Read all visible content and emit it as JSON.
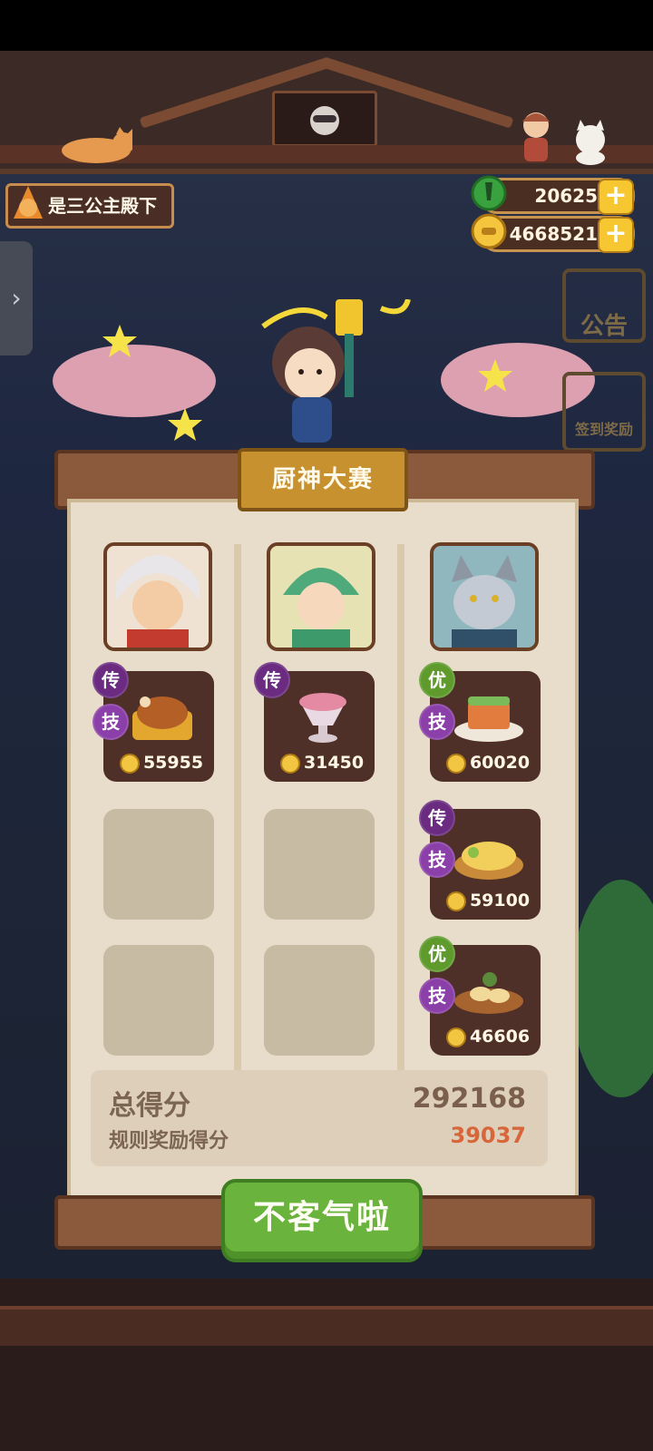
{
  "player": {
    "name": "是三公主殿下"
  },
  "currency": [
    {
      "icon": "green-gem-icon",
      "value": "20625",
      "plus": "+"
    },
    {
      "icon": "gold-coin-icon",
      "value": "4668521",
      "plus": "+"
    }
  ],
  "side_tab": {
    "arrow": "›"
  },
  "background_buttons": {
    "notice": "公告",
    "reward": "签到奖励"
  },
  "panel": {
    "title": "厨神大赛"
  },
  "columns": [
    {
      "chef": "white-haired-chef-portrait",
      "dishes": [
        {
          "badges": [
            "传",
            "技"
          ],
          "badge_colors": [
            "#6a2b80",
            "#8b3fa8"
          ],
          "icon": "roast-chicken-dish-icon",
          "score": "55955"
        }
      ],
      "empty_slots": 2
    },
    {
      "chef": "green-robed-chef-portrait",
      "dishes": [
        {
          "badges": [
            "传"
          ],
          "badge_colors": [
            "#6a2b80"
          ],
          "icon": "dessert-cup-dish-icon",
          "score": "31450"
        }
      ],
      "empty_slots": 2
    },
    {
      "chef": "wolf-captain-chef-portrait",
      "dishes": [
        {
          "badges": [
            "优",
            "技"
          ],
          "badge_colors": [
            "#5e9b2c",
            "#8b3fa8"
          ],
          "icon": "layered-cake-dish-icon",
          "score": "60020"
        },
        {
          "badges": [
            "传",
            "技"
          ],
          "badge_colors": [
            "#6a2b80",
            "#8b3fa8"
          ],
          "icon": "golden-noodle-dish-icon",
          "score": "59100"
        },
        {
          "badges": [
            "优",
            "技"
          ],
          "badge_colors": [
            "#5e9b2c",
            "#8b3fa8"
          ],
          "icon": "dumpling-platter-dish-icon",
          "score": "46606"
        }
      ],
      "empty_slots": 0
    }
  ],
  "score": {
    "total_label": "总得分",
    "total_value": "292168",
    "bonus_label": "规则奖励得分",
    "bonus_value": "39037"
  },
  "button": {
    "label": "不客气啦"
  },
  "colors": {
    "accent_green": "#6ab33c",
    "gold": "#c7912f",
    "bonus_orange": "#d8663a"
  }
}
